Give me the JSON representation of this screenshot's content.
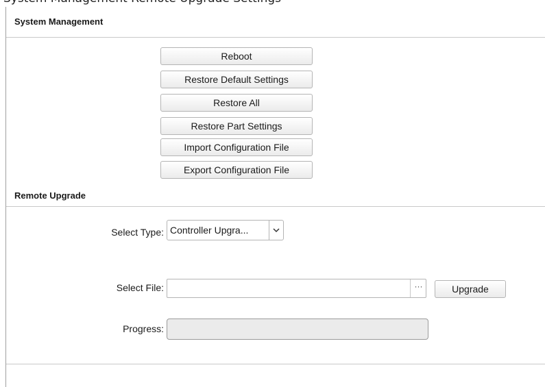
{
  "top_strip": {
    "text": "System Management Remote Upgrade Settings"
  },
  "system_management": {
    "title": "System Management",
    "buttons": [
      "Reboot",
      "Restore Default Settings",
      "Restore All",
      "Restore Part Settings",
      "Import Configuration File",
      "Export Configuration File"
    ]
  },
  "remote_upgrade": {
    "title": "Remote Upgrade",
    "select_type": {
      "label": "Select Type:",
      "value": "Controller Upgra..."
    },
    "select_file": {
      "label": "Select File:",
      "value": "",
      "browse_label": "···"
    },
    "upgrade_label": "Upgrade",
    "progress": {
      "label": "Progress:",
      "percent": 0
    }
  }
}
